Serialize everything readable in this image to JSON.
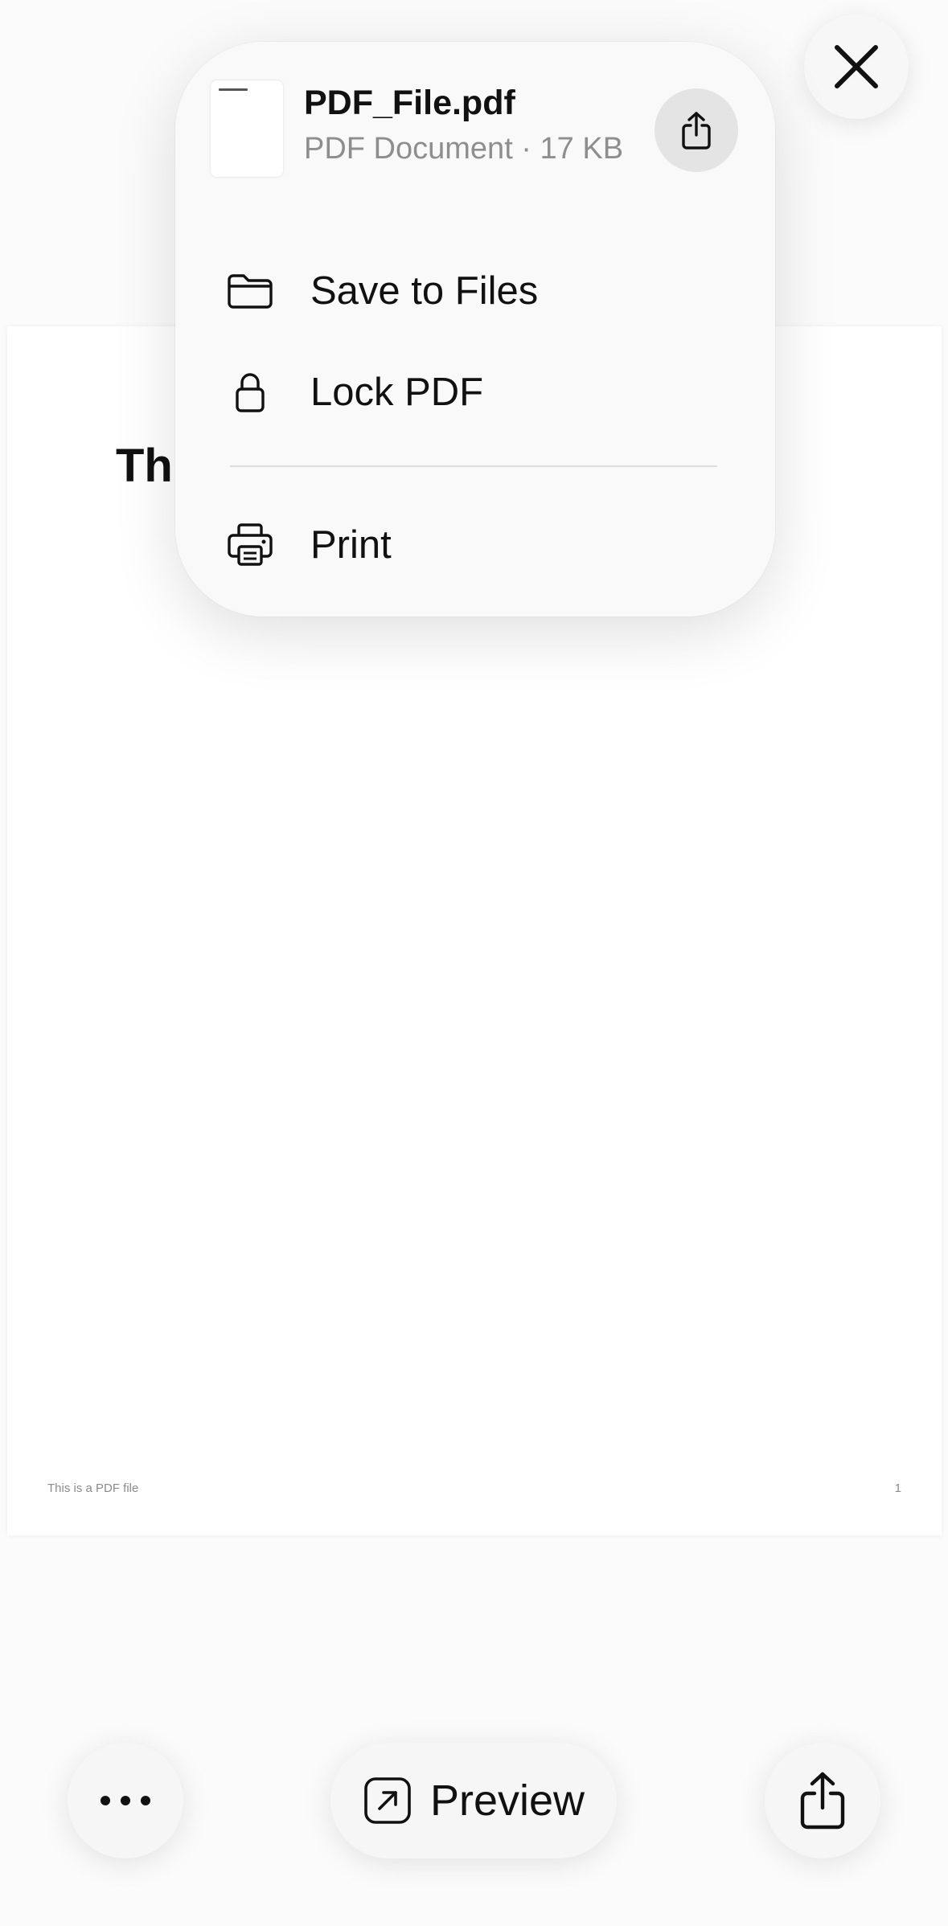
{
  "document": {
    "heading": "Th",
    "footer_text": "This is a PDF file",
    "page_number": "1"
  },
  "menu": {
    "file_name": "PDF_File.pdf",
    "file_meta": "PDF Document · 17 KB",
    "items": [
      {
        "label": "Save to Files",
        "icon": "folder-icon"
      },
      {
        "label": "Lock PDF",
        "icon": "lock-icon"
      },
      {
        "label": "Print",
        "icon": "printer-icon"
      }
    ]
  },
  "toolbar": {
    "more_icon": "ellipsis-icon",
    "preview_label": "Preview",
    "preview_icon": "open-external-icon",
    "share_icon": "share-icon"
  },
  "colors": {
    "background": "#fbfbfb",
    "panel": "#f9f9f9",
    "text": "#111111",
    "secondary_text": "#8e8e8e"
  }
}
